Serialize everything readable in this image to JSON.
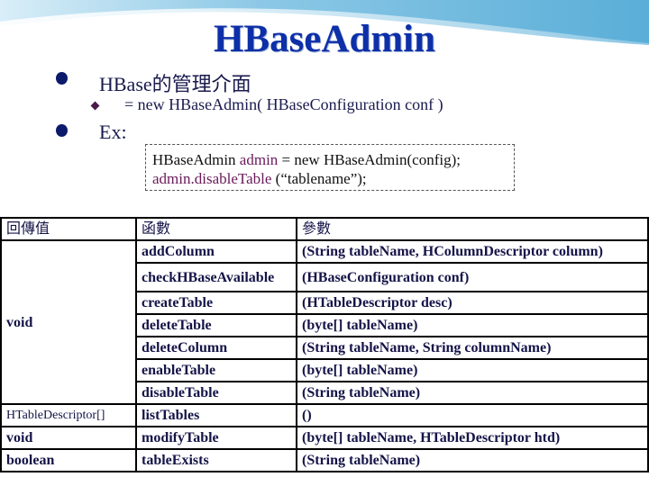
{
  "slide": {
    "title": "HBaseAdmin",
    "bullets": [
      {
        "level": 1,
        "text": "HBase的管理介面"
      },
      {
        "level": 2,
        "text": "= new HBaseAdmin( HBaseConfiguration conf )"
      },
      {
        "level": 1,
        "text": "Ex:"
      }
    ],
    "code": {
      "line1_prefix": "HBaseAdmin ",
      "line1_var": "admin",
      "line1_suffix": " = new HBaseAdmin(config);",
      "line2_call": "admin.disableTable",
      "line2_suffix": " (“tablename”);"
    },
    "colors": {
      "title": "#0d2fa8",
      "text": "#1a1a4e",
      "bullet_dot": "#0b1a6b",
      "bullet_diamond": "#4a1a4a",
      "code_highlight": "#6a1a5a",
      "banner": "#6fb7dc"
    }
  },
  "table": {
    "headers": [
      "回傳值",
      "函數",
      "參數"
    ],
    "rows": [
      {
        "return": "",
        "function": "addColumn",
        "params": "(String tableName, HColumnDescriptor column)"
      },
      {
        "return": "",
        "function": "checkHBaseAvailable",
        "params": "(HBaseConfiguration conf)"
      },
      {
        "return": "",
        "function": "createTable",
        "params": "(HTableDescriptor desc)"
      },
      {
        "return": "void",
        "function": "deleteTable",
        "params": "(byte[] tableName)"
      },
      {
        "return": "",
        "function": "deleteColumn",
        "params": "(String tableName, String columnName)"
      },
      {
        "return": "",
        "function": "enableTable",
        "params": "(byte[] tableName)"
      },
      {
        "return": "",
        "function": "disableTable",
        "params": "(String tableName)"
      },
      {
        "return": "HTableDescriptor[]",
        "function": "listTables",
        "params": "()"
      },
      {
        "return": "void",
        "function": "modifyTable",
        "params": "(byte[] tableName, HTableDescriptor htd)"
      },
      {
        "return": "boolean",
        "function": "tableExists",
        "params": "(String tableName)"
      }
    ]
  }
}
